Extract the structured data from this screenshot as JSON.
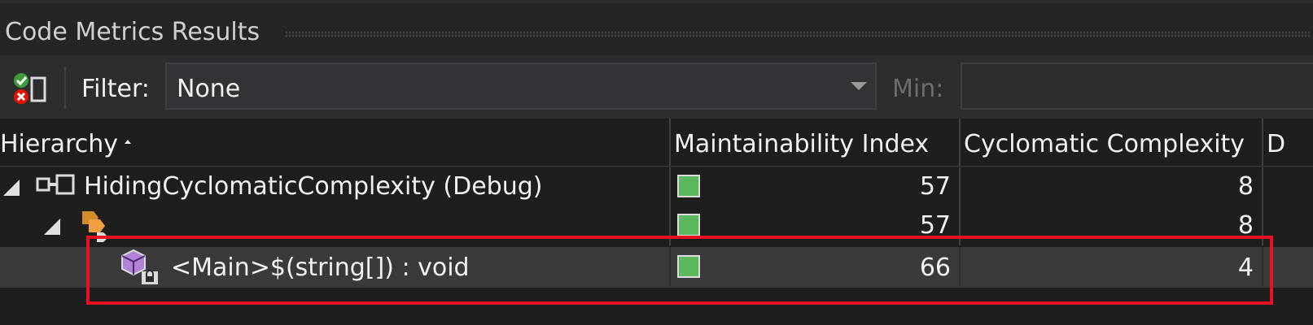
{
  "panel": {
    "title": "Code Metrics Results"
  },
  "toolbar": {
    "toggle_icon": "check-error-toggle-icon",
    "filter_label": "Filter:",
    "filter_value": "None",
    "min_label": "Min:",
    "min_value": ""
  },
  "columns": {
    "hierarchy": "Hierarchy",
    "maintainability": "Maintainability Index",
    "cyclomatic": "Cyclomatic Complexity",
    "next_partial": "D"
  },
  "rows": [
    {
      "label": "HidingCyclomaticComplexity (Debug)",
      "icon": "assembly-icon",
      "expanded": true,
      "maintainability_index": "57",
      "cyclomatic_complexity": "8",
      "rating_color": "#5cb85c"
    },
    {
      "label": "",
      "icon": "namespace-class-icon",
      "expanded": true,
      "maintainability_index": "57",
      "cyclomatic_complexity": "8",
      "rating_color": "#5cb85c"
    },
    {
      "label": "<Main>$(string[]) : void",
      "icon": "method-private-icon",
      "expanded": false,
      "selected": true,
      "maintainability_index": "66",
      "cyclomatic_complexity": "4",
      "rating_color": "#5cb85c"
    }
  ],
  "highlight_color": "#e81123"
}
